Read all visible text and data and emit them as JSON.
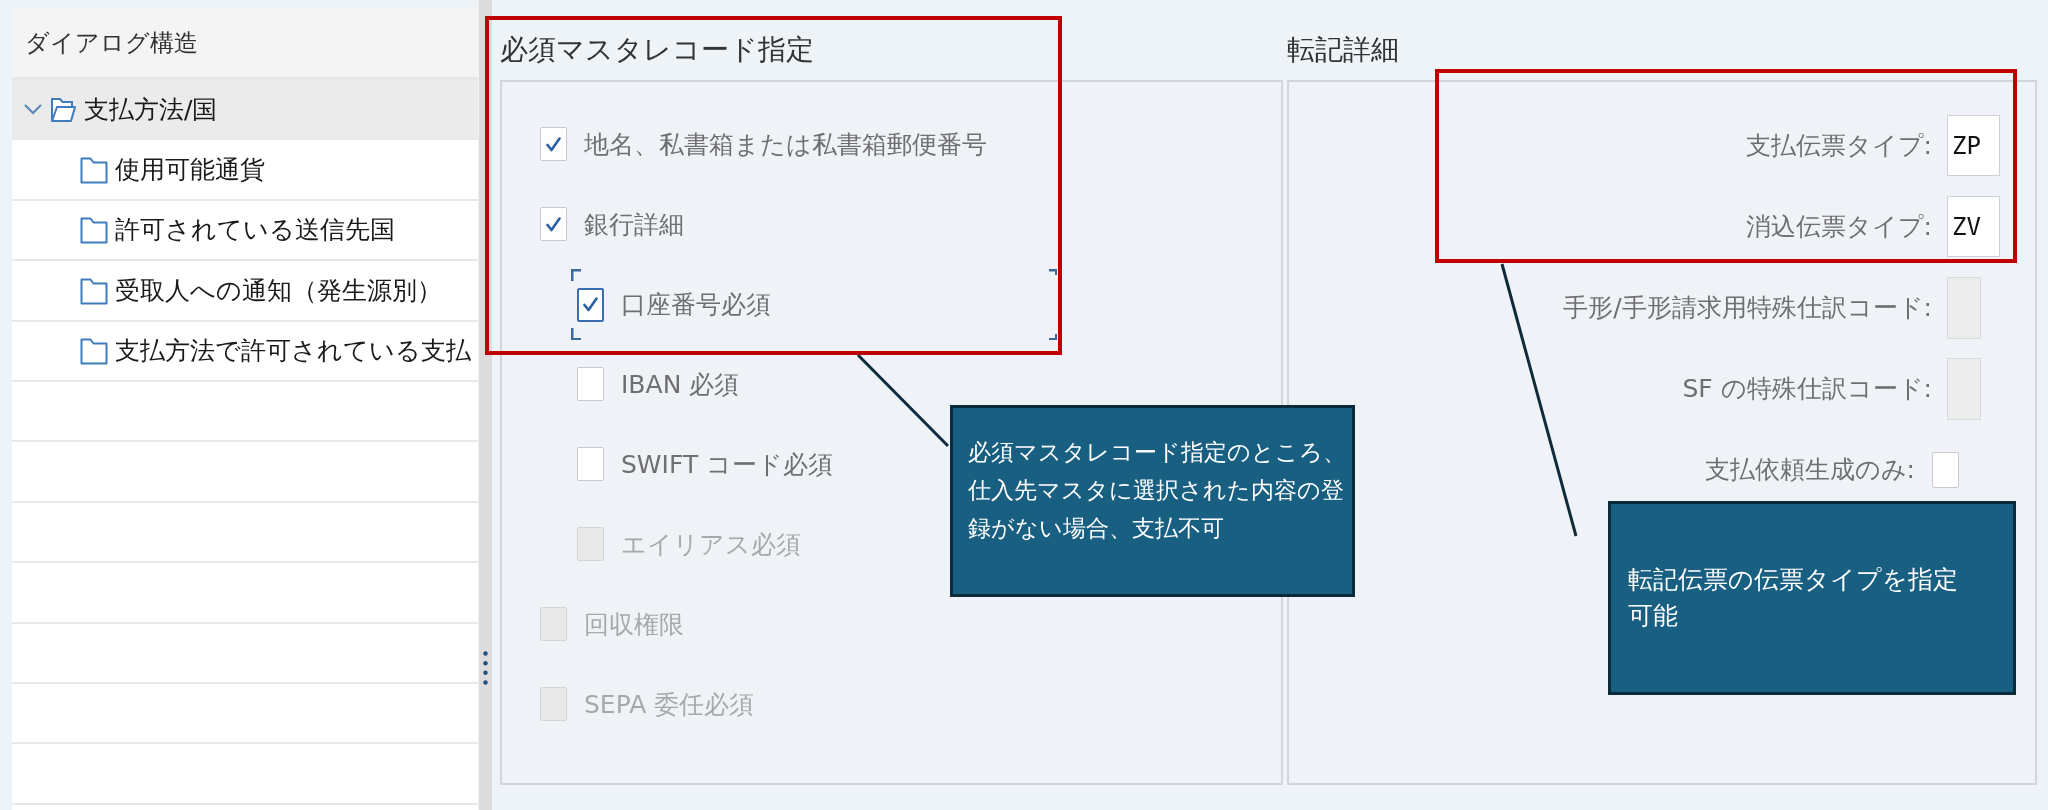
{
  "dialog_structure": {
    "title": "ダイアログ構造",
    "items": [
      {
        "label": "支払方法/国",
        "expanded": true,
        "selected": true,
        "children": [
          {
            "label": "使用可能通貨",
            "selected": false
          },
          {
            "label": "許可されている送信先国",
            "selected": false
          },
          {
            "label": "受取人への通知（発生源別）",
            "selected": false
          },
          {
            "label": "支払方法で許可されている支払",
            "selected": false
          }
        ]
      }
    ]
  },
  "mandatory_master_records": {
    "title": "必須マスタレコード指定",
    "options": [
      {
        "label": "地名、私書箱または私書箱郵便番号",
        "checked": true,
        "disabled": false,
        "focused": false
      },
      {
        "label": "銀行詳細",
        "checked": true,
        "disabled": false,
        "focused": false,
        "children": [
          {
            "label": "口座番号必須",
            "checked": true,
            "disabled": false,
            "focused": true
          },
          {
            "label": "IBAN 必須",
            "checked": false,
            "disabled": false,
            "focused": false
          },
          {
            "label": "SWIFT コード必須",
            "checked": false,
            "disabled": false,
            "focused": false
          },
          {
            "label": "エイリアス必須",
            "checked": false,
            "disabled": true,
            "focused": false
          }
        ]
      },
      {
        "label": "回収権限",
        "checked": false,
        "disabled": true,
        "focused": false
      },
      {
        "label": "SEPA 委任必須",
        "checked": false,
        "disabled": true,
        "focused": false
      }
    ]
  },
  "posting_details": {
    "title": "転記詳細",
    "fields": [
      {
        "kind": "text",
        "label": "支払伝票タイプ:",
        "value": "ZP",
        "disabled": false
      },
      {
        "kind": "text",
        "label": "消込伝票タイプ:",
        "value": "ZV",
        "disabled": false
      },
      {
        "kind": "text",
        "label": "手形/手形請求用特殊仕訳コード:",
        "disabled": true
      },
      {
        "kind": "text",
        "label": "SF の特殊仕訳コード:",
        "disabled": true
      },
      {
        "kind": "checkbox",
        "label": "支払依頼生成のみ:",
        "checked": false,
        "disabled": false
      }
    ]
  },
  "annotations": {
    "callouts": [
      {
        "text": "必須マスタレコード指定のところ、仕入先マスタに選択された内容の登録がない場合、支払不可"
      },
      {
        "text": "転記伝票の伝票タイプを指定可能"
      }
    ]
  }
}
